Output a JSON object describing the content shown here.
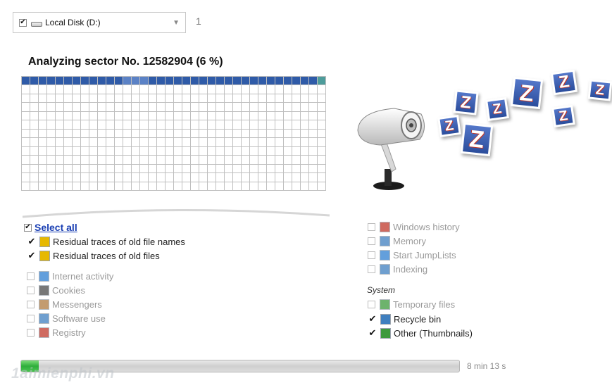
{
  "drive": {
    "label": "Local Disk (D:)",
    "checked": true,
    "count": "1"
  },
  "analysis": {
    "title": "Analyzing sector No. 12582904 (6 %)",
    "grid_columns": 36,
    "grid_rows": 13,
    "filled_cells": 36
  },
  "select_all": "Select all",
  "left_options": [
    {
      "label": "Residual traces of old file names",
      "checked": true,
      "icon": "file-trace-icon",
      "color": "#e6b800"
    },
    {
      "label": "Residual traces of old files",
      "checked": true,
      "icon": "file-trace-icon",
      "color": "#e6b800"
    },
    {
      "label": "Internet activity",
      "checked": false,
      "icon": "globe-icon",
      "color": "#2f7fd1"
    },
    {
      "label": "Cookies",
      "checked": false,
      "icon": "person-icon",
      "color": "#4a4a4a"
    },
    {
      "label": "Messengers",
      "checked": false,
      "icon": "people-icon",
      "color": "#b07a3f"
    },
    {
      "label": "Software use",
      "checked": false,
      "icon": "window-icon",
      "color": "#3f7fbf"
    },
    {
      "label": "Registry",
      "checked": false,
      "icon": "registry-icon",
      "color": "#c0392b"
    }
  ],
  "right_options": [
    {
      "label": "Windows history",
      "checked": false,
      "icon": "bar-chart-icon",
      "color": "#c0392b"
    },
    {
      "label": "Memory",
      "checked": false,
      "icon": "memory-icon",
      "color": "#3f7fbf"
    },
    {
      "label": "Start JumpLists",
      "checked": false,
      "icon": "power-icon",
      "color": "#2f7fd1"
    },
    {
      "label": "Indexing",
      "checked": false,
      "icon": "index-icon",
      "color": "#3f7fbf"
    }
  ],
  "system": {
    "label": "System",
    "options": [
      {
        "label": "Temporary files",
        "checked": false,
        "icon": "temp-files-icon",
        "color": "#3d9a3d"
      },
      {
        "label": "Recycle bin",
        "checked": true,
        "icon": "recycle-bin-icon",
        "color": "#3f7fbf"
      },
      {
        "label": "Other (Thumbnails)",
        "checked": true,
        "icon": "thumbnails-icon",
        "color": "#3d9a3d"
      }
    ]
  },
  "progress": {
    "fraction": 0.04,
    "time_left": "8 min 13 s"
  },
  "watermark": "1aimienphi.vn",
  "z_cards": [
    "Z",
    "Z",
    "Z",
    "Z",
    "Z",
    "Z",
    "Z",
    "Z"
  ]
}
